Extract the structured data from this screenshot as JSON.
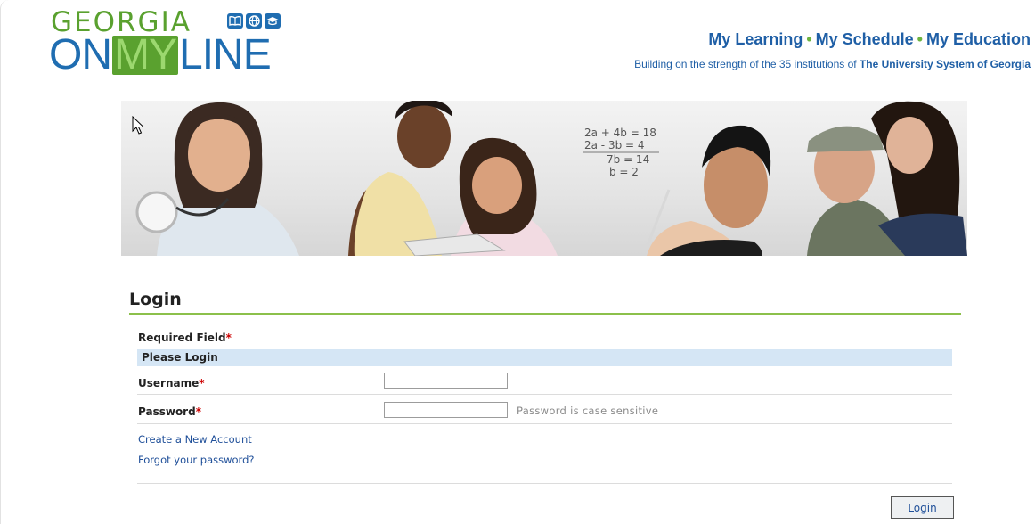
{
  "logo": {
    "line1": "GEORGIA",
    "line2_pre": "ON",
    "line2_my": "MY",
    "line2_post": "LINE",
    "icons": [
      "book-icon",
      "globe-icon",
      "graduation-cap-icon"
    ]
  },
  "header": {
    "tag1": "My Learning",
    "tag2": "My Schedule",
    "tag3": "My Education",
    "dot": "•",
    "subline_pre": "Building on the strength of the 35 institutions of",
    "subline_bold": "The University System of Georgia"
  },
  "banner": {
    "math_lines": [
      "2a + 4b = 18",
      "2a - 3b = 4",
      "7b = 14",
      "b = 2"
    ]
  },
  "login": {
    "title": "Login",
    "required_label": "Required Field",
    "required_star": "*",
    "please_login": "Please Login",
    "username_label": "Username",
    "username_value": "",
    "password_label": "Password",
    "password_value": "",
    "password_hint": "Password is case sensitive",
    "create_account": "Create a New Account",
    "forgot_password": "Forgot your password?",
    "login_button": "Login"
  },
  "colors": {
    "brand_blue": "#1f6db1",
    "brand_green": "#5aa12f",
    "title_rule": "#8cc04b",
    "header_bar": "#d5e6f5"
  }
}
